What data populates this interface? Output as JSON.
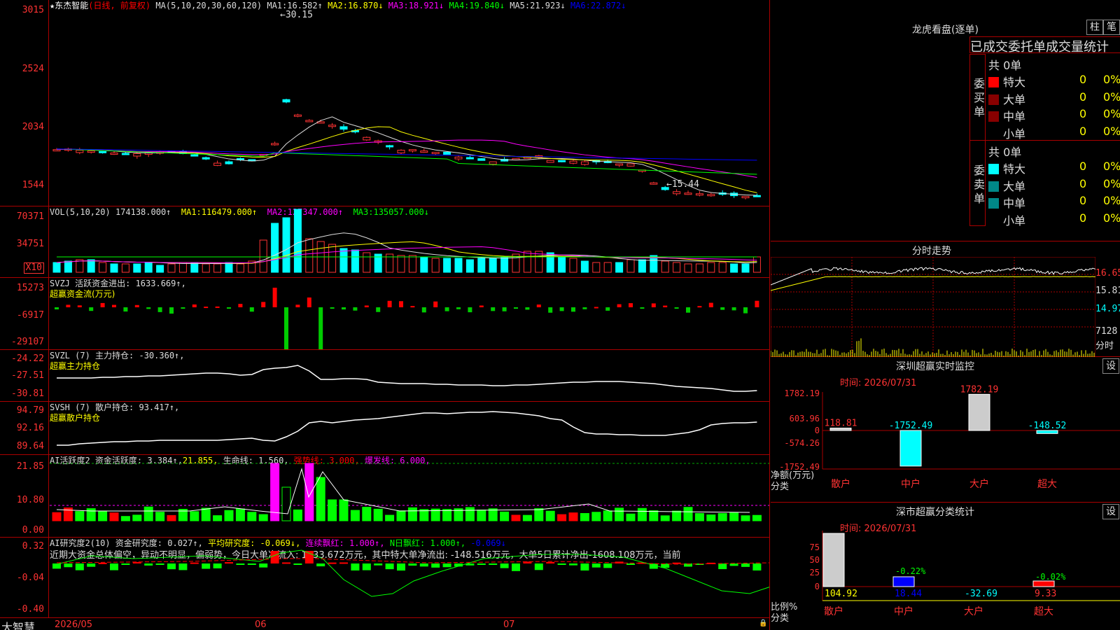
{
  "main": {
    "stock": "东杰智能",
    "mode": "(日线, 前复权)",
    "ma_label": "MA(5,10,20,30,60,120)",
    "ma": [
      {
        "l": "MA1:",
        "v": "16.582↑"
      },
      {
        "l": "MA2:",
        "v": "16.870↓"
      },
      {
        "l": "MA3:",
        "v": "18.921↓"
      },
      {
        "l": "MA4:",
        "v": "19.840↓"
      },
      {
        "l": "MA5:",
        "v": "21.923↓"
      },
      {
        "l": "MA6:",
        "v": "22.872↓"
      }
    ],
    "ticks": [
      "3015",
      "2524",
      "2034",
      "1544"
    ],
    "high": "←30.15",
    "low": "←15.44"
  },
  "vol": {
    "label": "VOL(5,10,20)",
    "v": "174138.000↑",
    "ma": [
      {
        "l": "MA1:",
        "v": "116479.000↑"
      },
      {
        "l": "MA2:",
        "v": "127347.000↑"
      },
      {
        "l": "MA3:",
        "v": "135057.000↓"
      }
    ],
    "ticks": [
      "70371",
      "34751",
      "X10"
    ]
  },
  "svzj": {
    "label": "SVZJ 活跃资金进出: 1633.669↑,",
    "sub": "超赢资金流(万元)",
    "ticks": [
      "15273",
      "-6917",
      "-29107"
    ]
  },
  "svzl": {
    "label": "SVZL (7) 主力持仓: -30.360↑,",
    "sub": "超赢主力持仓",
    "ticks": [
      "-24.22",
      "-27.51",
      "-30.81"
    ]
  },
  "svsh": {
    "label": "SVSH (7) 散户持仓: 93.417↑,",
    "sub": "超赢散户持仓",
    "ticks": [
      "94.79",
      "92.16",
      "89.64"
    ]
  },
  "ai": {
    "label": "AI活跃度2 资金活跃度: 3.384↑,",
    "v2": "21.855,",
    "v3": "生命线: 1.560,",
    "v4": "强势线: 3.000,",
    "v5": "爆发线: 6.000,",
    "ticks": [
      "21.85",
      "10.80",
      "0.00"
    ]
  },
  "ai2": {
    "label": "AI研究度2(10) 资金研究度: 0.027↑,",
    "v2": "平均研究度: -0.069↓,",
    "v3": "连续飘红: 1.000↑,",
    "v4": "N日飘红: 1.000↑,",
    "v5": "-0.069↓",
    "text": "近期大资金总体偏空，异动不明显，偏弱势，今日大单净流入: 1633.672万元，其中特大单净流出: -148.516万元，大单5日累计净出-1608.108万元，当前",
    "ticks": [
      "0.32",
      "-0.04",
      "-0.40"
    ]
  },
  "footer": {
    "brand": "大智慧",
    "dates": [
      "2026/05",
      "06",
      "07"
    ]
  },
  "lhb": {
    "title": "龙虎看盘(逐单)",
    "btn1": "柱",
    "btn2": "笔",
    "sub": "已成交委托单成交量统计",
    "buy": "委买单",
    "sell": "委卖单",
    "count": "共 0单",
    "rows": [
      {
        "n": "特大",
        "v": "0",
        "p": "0%"
      },
      {
        "n": "大单",
        "v": "0",
        "p": "0%"
      },
      {
        "n": "中单",
        "v": "0",
        "p": "0%"
      },
      {
        "n": "小单",
        "v": "0",
        "p": "0%"
      }
    ]
  },
  "fs": {
    "title": "分时走势",
    "ticks": [
      "16.65",
      "15.81",
      "14.97",
      "7128",
      "分时"
    ]
  },
  "sz": {
    "title": "深圳超赢实时监控",
    "btn": "设",
    "time": "时间: 2026/07/31",
    "ticks": [
      "1782.19",
      "603.96",
      "0",
      "-574.26",
      "-1752.49"
    ],
    "y1": "净额(万元)",
    "y2": "分类",
    "cats": [
      "散户",
      "中户",
      "大户",
      "超大"
    ],
    "values": [
      118.81,
      -1752.49,
      1782.19,
      -148.52
    ],
    "labels": [
      "118.81",
      "-1752.49",
      "1782.19",
      "-148.52"
    ]
  },
  "ss": {
    "title": "深市超赢分类统计",
    "btn": "设",
    "time": "时间: 2026/07/31",
    "ticks": [
      "75",
      "50",
      "25",
      "0"
    ],
    "y1": "比例%",
    "y2": "分类",
    "cats": [
      "散户",
      "中户",
      "大户",
      "超大"
    ],
    "vals": [
      "104.92",
      "18.44",
      "-32.69",
      "9.33"
    ],
    "pct": [
      "-0.22%",
      "-0.02%"
    ]
  }
}
